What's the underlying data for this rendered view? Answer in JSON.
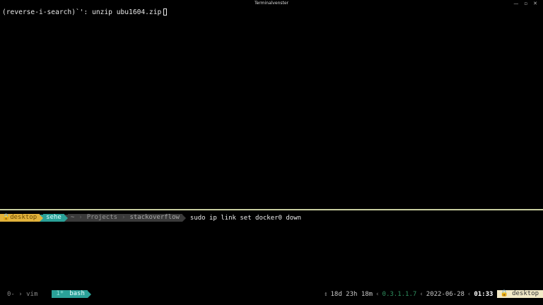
{
  "window": {
    "title": "Terminalvenster",
    "controls": [
      "—",
      "▫",
      "✕"
    ]
  },
  "top_pane": {
    "search_line": "(reverse-i-search)`': unzip ubu1604.zip"
  },
  "prompt": {
    "user": "desktop",
    "host": "sehe",
    "home": "~",
    "dir1": "Projects",
    "dir2": "stackoverflow",
    "command": "sudo ip link set docker0 down"
  },
  "tmux_status": {
    "inactive_window_index": "0-",
    "inactive_window_name": "vim",
    "active_window_index": "1*",
    "active_window_name": "bash",
    "uptime": "18d 23h 18m",
    "ip": "0.3.1.1.7",
    "date": "2022-06-28",
    "time": "01:33",
    "host": "desktop"
  },
  "colors": {
    "background": "#000000",
    "user_segment": "#e2b33c",
    "host_segment": "#2aa198",
    "path_segment": "#3a3a3a",
    "divider": "#c9cfa0",
    "host_badge": "#f2eac7"
  }
}
